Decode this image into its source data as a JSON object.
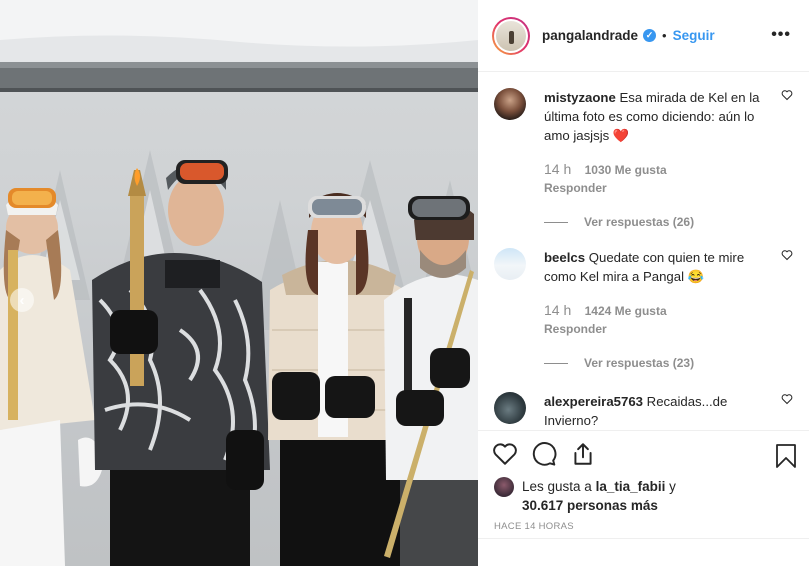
{
  "post": {
    "username": "pangalandrade",
    "verified_icon": "verified-badge-icon",
    "separator": "•",
    "follow_label": "Seguir",
    "more_label": "•••"
  },
  "comments": [
    {
      "username": "mistyzaone",
      "text": "Esa mirada de Kel en la última foto es como diciendo: aún lo amo jasjsjs",
      "emoji": "❤️",
      "time": "14 h",
      "likes": "1030 Me gusta",
      "reply_label": "Responder",
      "view_replies": "Ver respuestas (26)"
    },
    {
      "username": "beelcs",
      "text": "Quedate con quien te mire como Kel mira a Pangal",
      "emoji": "😂",
      "time": "14 h",
      "likes": "1424 Me gusta",
      "reply_label": "Responder",
      "view_replies": "Ver respuestas (23)"
    },
    {
      "username": "alexpereira5763",
      "text": "Recaidas...de Invierno?"
    }
  ],
  "likes": {
    "prefix": "Les gusta a",
    "user": "la_tia_fabii",
    "suffix": "y",
    "count": "30.617 personas más"
  },
  "timestamp": "HACE 14 HORAS",
  "colors": {
    "link": "#3897f0",
    "muted": "#8e8e8e",
    "text": "#262626",
    "heart": "#ed4956"
  },
  "carousel": {
    "prev_icon": "chevron-left-icon"
  }
}
